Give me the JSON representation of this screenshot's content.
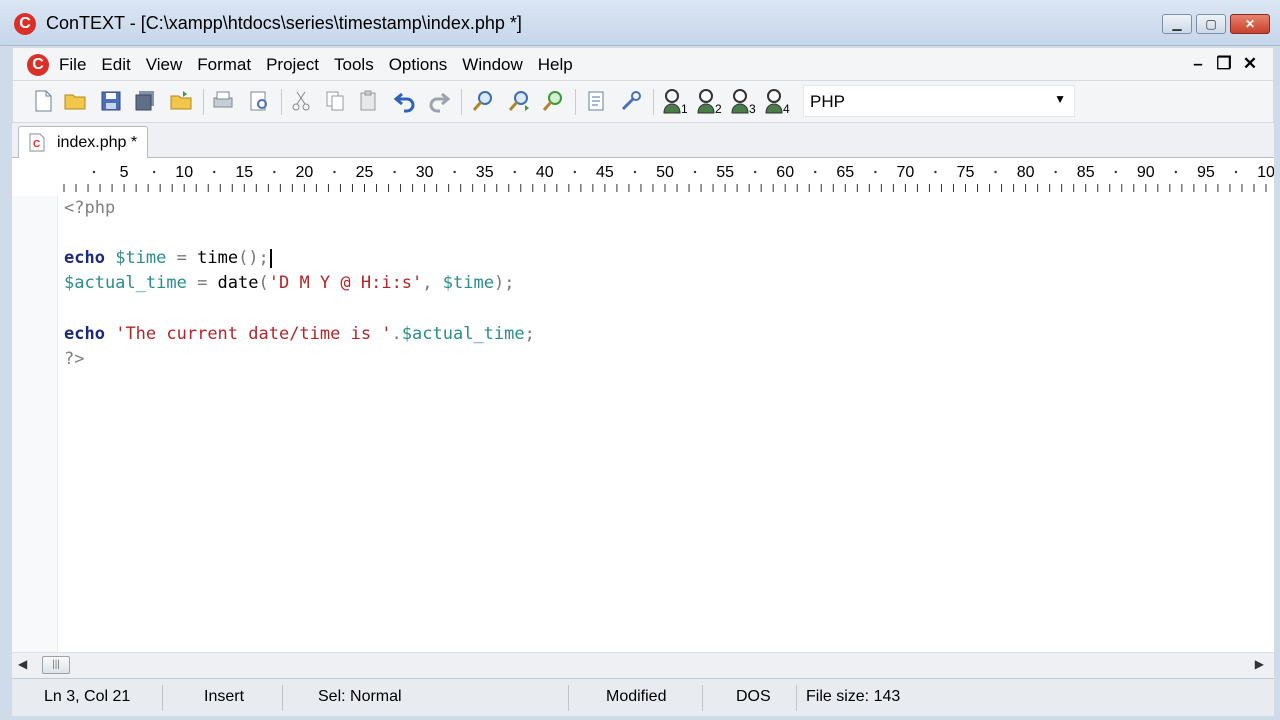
{
  "window": {
    "title": "ConTEXT - [C:\\xampp\\htdocs\\series\\timestamp\\index.php *]",
    "logo_letter": "C"
  },
  "menu": {
    "items": [
      "File",
      "Edit",
      "View",
      "Format",
      "Project",
      "Tools",
      "Options",
      "Window",
      "Help"
    ]
  },
  "toolbar": {
    "user_buttons": [
      "1",
      "2",
      "3",
      "4"
    ],
    "language_value": "PHP",
    "icons": [
      "new-file-icon",
      "open-folder-icon",
      "save-icon",
      "save-all-icon",
      "open-project-icon",
      "print-icon",
      "print-preview-icon",
      "cut-icon",
      "copy-icon",
      "paste-icon",
      "undo-icon",
      "redo-icon",
      "find-icon",
      "find-next-icon",
      "replace-icon",
      "export-icon",
      "tools-icon"
    ]
  },
  "tabs": [
    {
      "label": "index.php *",
      "active": true
    }
  ],
  "ruler": {
    "marks": [
      "5",
      "10",
      "15",
      "20",
      "25",
      "30",
      "35",
      "40",
      "45",
      "50",
      "55",
      "60",
      "65",
      "70",
      "75",
      "80",
      "85",
      "90",
      "95",
      "10"
    ]
  },
  "editor": {
    "lines": {
      "open_tag": "<?php",
      "l3_kw": "echo",
      "l3_var": "$time",
      "l3_eq": " = ",
      "l3_fn": "time",
      "l3_rest": "();",
      "l4_var": "$actual_time",
      "l4_eq": " = ",
      "l4_fn": "date",
      "l4_paren": "(",
      "l4_str": "'D M Y @ H:i:s'",
      "l4_comma": ", ",
      "l4_var2": "$time",
      "l4_rest": ");",
      "l6_kw": "echo",
      "l6_str": "'The current date/time is '",
      "l6_dot": ".",
      "l6_var": "$actual_time",
      "l6_rest": ";",
      "close_tag": "?>"
    }
  },
  "scrollbar": {
    "left_arrow": "◀",
    "right_arrow": "▶",
    "thumb_grip": "|||"
  },
  "status": {
    "position": "Ln 3, Col 21",
    "mode": "Insert",
    "selection": "Sel: Normal",
    "modified": "Modified",
    "line_ending": "DOS",
    "file_size": "File size: 143"
  },
  "colors": {
    "keyword": "#1b2a7a",
    "variable": "#2b8c8c",
    "string": "#b1262a",
    "logo": "#d9302a"
  }
}
